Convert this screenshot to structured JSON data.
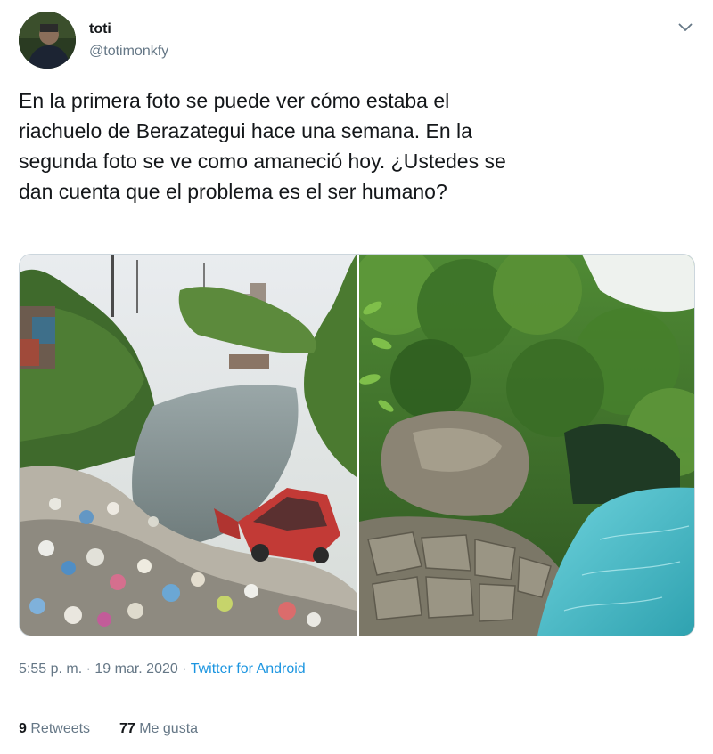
{
  "author": {
    "name": "toti",
    "handle": "@totimonkfy"
  },
  "tweet": {
    "lines": [
      "En la primera foto se puede ver cómo estaba el",
      "riachuelo de Berazategui hace una semana. En la",
      "segunda foto se ve como amaneció hoy. ¿Ustedes se",
      "dan cuenta que el problema es el ser humano?"
    ]
  },
  "meta": {
    "time": "5:55 p. m.",
    "separator": " · ",
    "date": "19 mar. 2020",
    "separator2": " · ",
    "source": "Twitter for Android"
  },
  "stats": {
    "retweets_count": "9",
    "retweets_label": "Retweets",
    "likes_count": "77",
    "likes_label": "Me gusta"
  },
  "colors": {
    "link": "#1b95e0",
    "secondary_text": "#657786",
    "primary_text": "#14171a",
    "divider": "#e6ecf0"
  },
  "icons": {
    "caret": "chevron-down-icon"
  }
}
